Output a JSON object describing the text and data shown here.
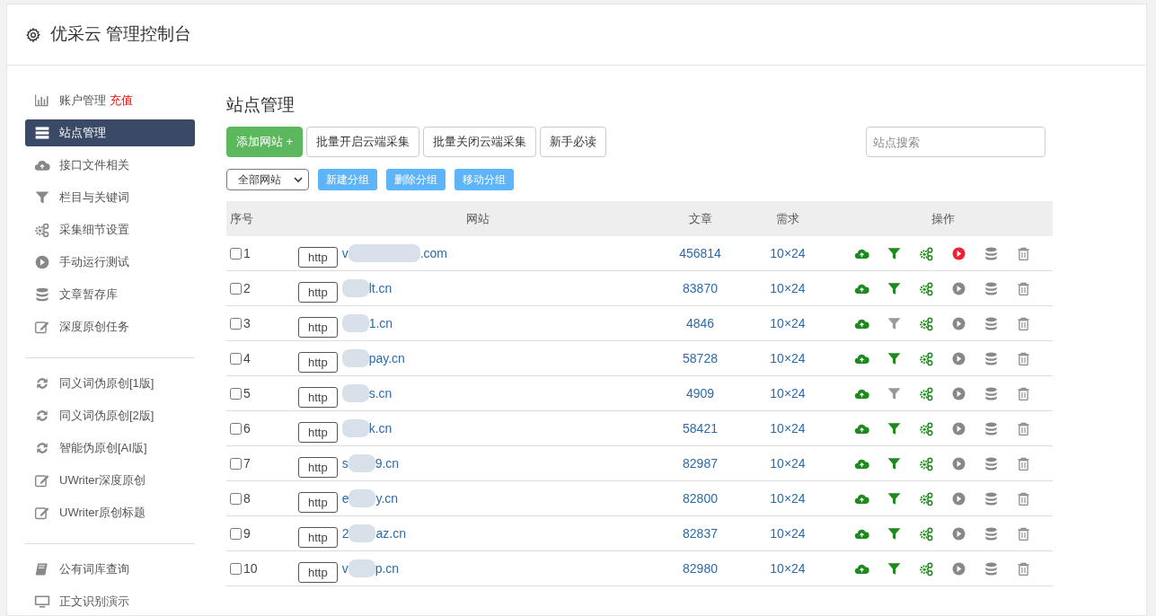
{
  "header": {
    "title": "优采云 管理控制台"
  },
  "sidebar": {
    "groups": [
      [
        {
          "label": "账户管理",
          "badge": "充值",
          "selected": false
        },
        {
          "label": "站点管理",
          "selected": true
        },
        {
          "label": "接口文件相关",
          "selected": false
        },
        {
          "label": "栏目与关键词",
          "selected": false
        },
        {
          "label": "采集细节设置",
          "selected": false
        },
        {
          "label": "手动运行测试",
          "selected": false
        },
        {
          "label": "文章暂存库",
          "selected": false
        },
        {
          "label": "深度原创任务",
          "selected": false
        }
      ],
      [
        {
          "label": "同义词伪原创[1版]",
          "selected": false
        },
        {
          "label": "同义词伪原创[2版]",
          "selected": false
        },
        {
          "label": "智能伪原创[AI版]",
          "selected": false
        },
        {
          "label": "UWriter深度原创",
          "selected": false
        },
        {
          "label": "UWriter原创标题",
          "selected": false
        }
      ],
      [
        {
          "label": "公有词库查询",
          "selected": false
        },
        {
          "label": "正文识别演示",
          "selected": false
        }
      ]
    ]
  },
  "main": {
    "title": "站点管理",
    "toolbar": [
      {
        "label": "添加网站 +",
        "kind": "primary"
      },
      {
        "label": "批量开启云端采集",
        "kind": "default"
      },
      {
        "label": "批量关闭云端采集",
        "kind": "default"
      },
      {
        "label": "新手必读",
        "kind": "default"
      }
    ],
    "search": {
      "placeholder": "站点搜索"
    },
    "group_select": {
      "value": "全部网站"
    },
    "group_buttons": [
      "新建分组",
      "删除分组",
      "移动分组"
    ],
    "table": {
      "columns": [
        "序号",
        "网站",
        "文章",
        "需求",
        "操作"
      ],
      "rows": [
        {
          "checked": false,
          "index": "1",
          "scheme": "http",
          "prefix": "v",
          "suffix": ".com",
          "articles": "456814",
          "demand": "10×24",
          "filter_on": true,
          "running": true
        },
        {
          "checked": false,
          "index": "2",
          "scheme": "http",
          "suffix": "lt.cn",
          "articles": "83870",
          "demand": "10×24",
          "filter_on": true,
          "running": false
        },
        {
          "checked": false,
          "index": "3",
          "scheme": "http",
          "suffix": "1.cn",
          "articles": "4846",
          "demand": "10×24",
          "filter_on": false,
          "running": false
        },
        {
          "checked": false,
          "index": "4",
          "scheme": "http",
          "suffix": "pay.cn",
          "articles": "58728",
          "demand": "10×24",
          "filter_on": true,
          "running": false
        },
        {
          "checked": false,
          "index": "5",
          "scheme": "http",
          "suffix": "s.cn",
          "articles": "4909",
          "demand": "10×24",
          "filter_on": false,
          "running": false
        },
        {
          "checked": false,
          "index": "6",
          "scheme": "http",
          "suffix": "k.cn",
          "articles": "58421",
          "demand": "10×24",
          "filter_on": true,
          "running": false
        },
        {
          "checked": false,
          "index": "7",
          "scheme": "http",
          "prefix": "s",
          "suffix": "9.cn",
          "articles": "82987",
          "demand": "10×24",
          "filter_on": true,
          "running": false
        },
        {
          "checked": false,
          "index": "8",
          "scheme": "http",
          "prefix": "e",
          "suffix": "y.cn",
          "articles": "82800",
          "demand": "10×24",
          "filter_on": true,
          "running": false
        },
        {
          "checked": false,
          "index": "9",
          "scheme": "http",
          "prefix": "2",
          "suffix": "az.cn",
          "articles": "82837",
          "demand": "10×24",
          "filter_on": true,
          "running": false
        },
        {
          "checked": false,
          "index": "10",
          "scheme": "http",
          "prefix": "v",
          "suffix": "p.cn",
          "articles": "82980",
          "demand": "10×24",
          "filter_on": true,
          "running": false
        }
      ]
    }
  }
}
